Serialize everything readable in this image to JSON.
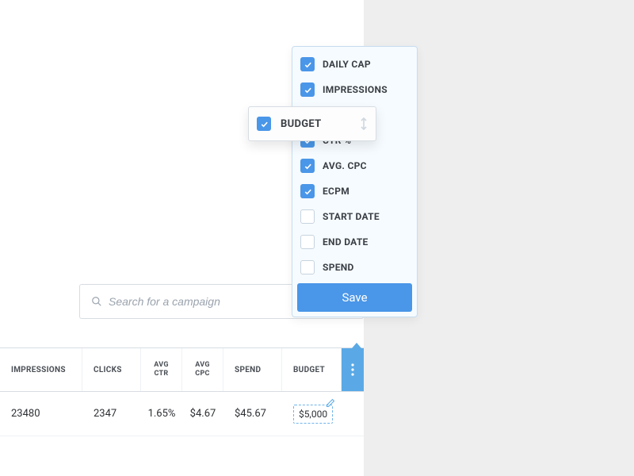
{
  "search": {
    "placeholder": "Search for a campaign"
  },
  "table": {
    "headers": {
      "impressions": "IMPRESSIONS",
      "clicks": "CLICKS",
      "avg_ctr_l1": "AVG",
      "avg_ctr_l2": "CTR",
      "avg_cpc_l1": "AVG",
      "avg_cpc_l2": "CPC",
      "spend": "SPEND",
      "budget": "BUDGET"
    },
    "row": {
      "impressions": "23480",
      "clicks": "2347",
      "avg_ctr": "1.65%",
      "avg_cpc": "$4.67",
      "spend": "$45.67",
      "budget": "$5,000"
    }
  },
  "columns_popover": {
    "items": [
      {
        "label": "DAILY CAP",
        "checked": true
      },
      {
        "label": "IMPRESSIONS",
        "checked": true
      },
      {
        "label": "",
        "checked": false,
        "slot": true
      },
      {
        "label": "CTR %",
        "checked": true
      },
      {
        "label": "AVG. CPC",
        "checked": true
      },
      {
        "label": "ECPM",
        "checked": true
      },
      {
        "label": "START DATE",
        "checked": false
      },
      {
        "label": "END DATE",
        "checked": false
      },
      {
        "label": "SPEND",
        "checked": false
      }
    ],
    "save_label": "Save"
  },
  "drag_chip": {
    "label": "BUDGET",
    "checked": true
  },
  "colors": {
    "accent": "#4a96e8",
    "header_accent": "#5aa9e6"
  }
}
